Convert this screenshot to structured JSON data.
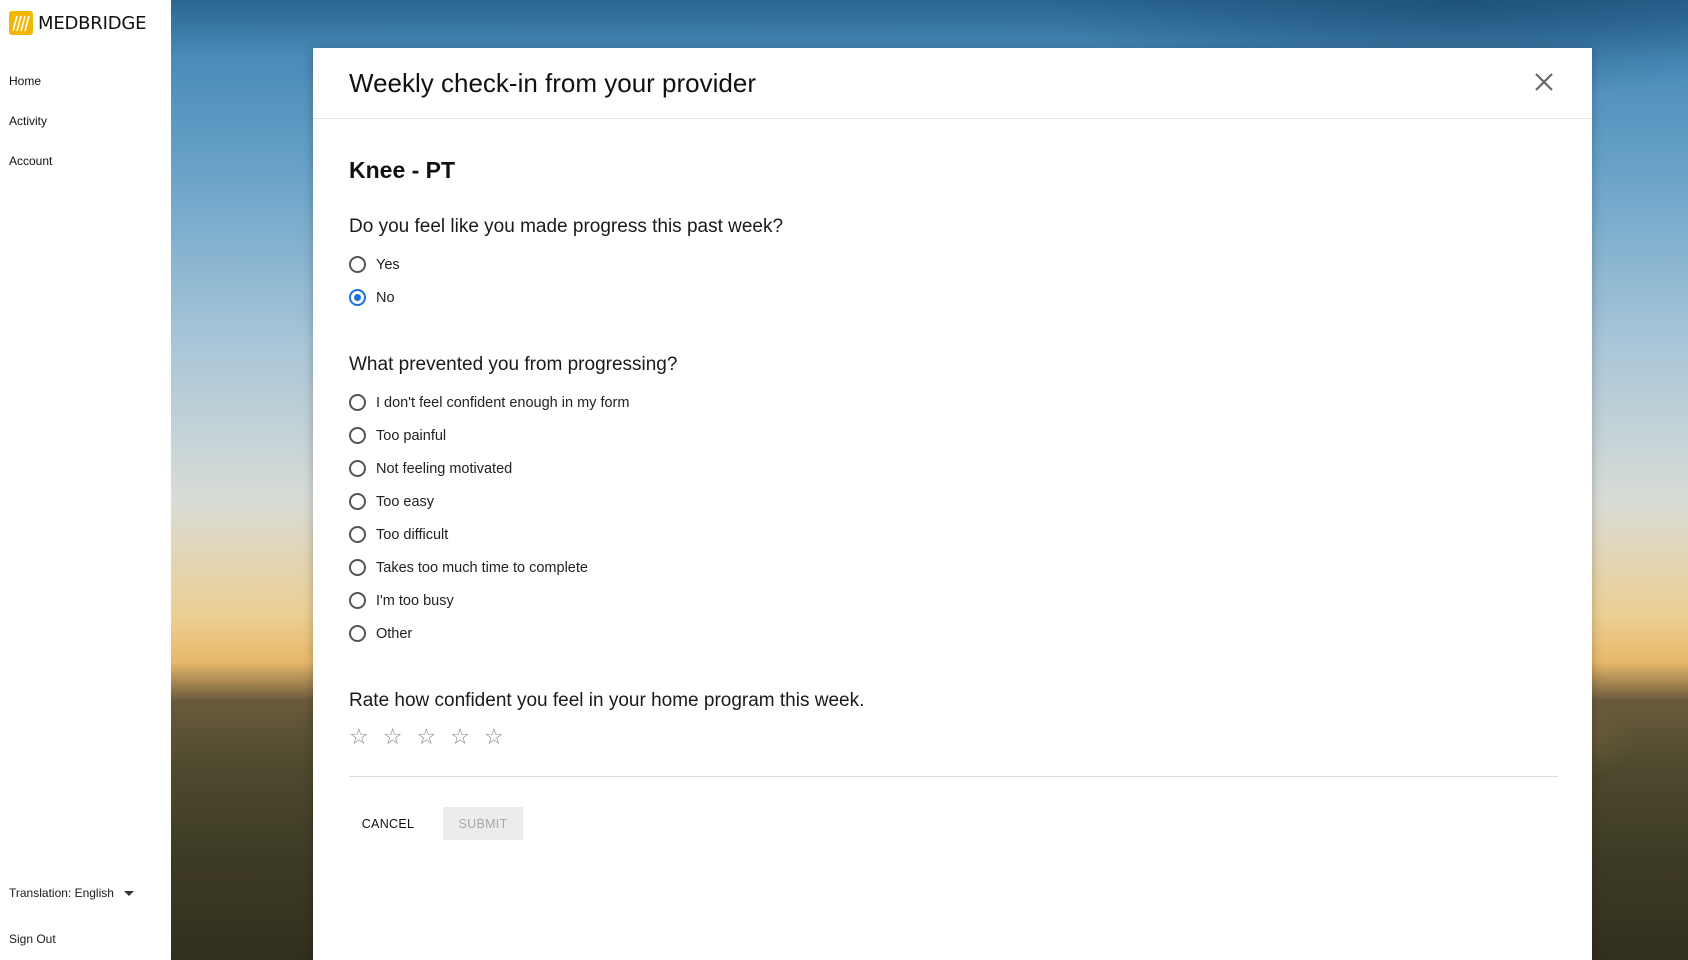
{
  "sidebar": {
    "brand": "MEDBRIDGE",
    "nav": [
      {
        "label": "Home"
      },
      {
        "label": "Activity"
      },
      {
        "label": "Account"
      }
    ],
    "translation_label": "Translation: English",
    "sign_out": "Sign Out"
  },
  "modal": {
    "title": "Weekly check-in from your provider",
    "section_title": "Knee - PT",
    "q1": {
      "question": "Do you feel like you made progress this past week?",
      "options": [
        {
          "label": "Yes",
          "checked": false
        },
        {
          "label": "No",
          "checked": true
        }
      ]
    },
    "q2": {
      "question": "What prevented you from progressing?",
      "options": [
        {
          "label": "I don't feel confident enough in my form",
          "checked": false
        },
        {
          "label": "Too painful",
          "checked": false
        },
        {
          "label": "Not feeling motivated",
          "checked": false
        },
        {
          "label": "Too easy",
          "checked": false
        },
        {
          "label": "Too difficult",
          "checked": false
        },
        {
          "label": "Takes too much time to complete",
          "checked": false
        },
        {
          "label": "I'm too busy",
          "checked": false
        },
        {
          "label": "Other",
          "checked": false
        }
      ]
    },
    "q3": {
      "question": "Rate how confident you feel in your home program this week.",
      "rating": 0,
      "max_rating": 5,
      "star_glyph": "☆"
    },
    "cancel_label": "CANCEL",
    "submit_label": "SUBMIT"
  },
  "colors": {
    "accent": "#1a73d9",
    "brand_yellow": "#f2b705",
    "submit_disabled_bg": "#ececec",
    "submit_disabled_text": "#a8a8a8"
  }
}
